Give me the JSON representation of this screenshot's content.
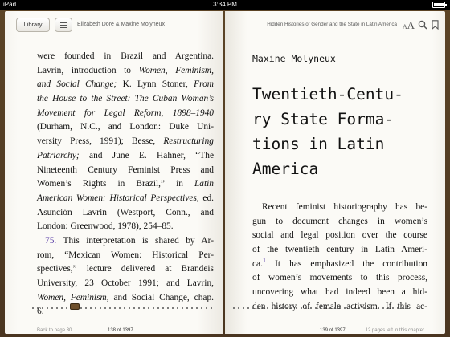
{
  "status": {
    "device": "iPad",
    "time": "3:34 PM",
    "battery_level": 0.9
  },
  "toolbar": {
    "library_label": "Library",
    "left_header": "Elizabeth Dore & Maxine Molyneux",
    "right_header": "Hidden Histories of Gender and the State in Latin America",
    "font_small": "A",
    "font_large": "A"
  },
  "left_page": {
    "lines": [
      "were founded in Brazil and Argentina.",
      "Lavrin, introduction to Women, Feminism,",
      "and Social Change; K. Lynn Stoner, From",
      "the House to the Street: The Cuban Woman’s",
      "Movement for Legal Reform, 1898–1940",
      "(Durham, N.C., and London: Duke Uni-",
      "versity Press, 1991); Besse, Restructuring",
      "Patriarchy; and June E. Hahner, “The",
      "Nineteenth Century Feminist Press and",
      "Women’s Rights in Brazil,” in Latin",
      "American Women: Historical Perspectives, ed.",
      "Asunción Lavrin (Westport, Conn., and",
      "London: Greenwood, 1978), 254–85."
    ],
    "note_number": "75.",
    "note_lines": [
      "This interpretation is shared by Ar-",
      "rom, “Mexican Women: Historical Per-",
      "spectives,” lecture delivered at Brandeis",
      "University, 23 October 1991; and Lavrin,",
      "Women, Feminism, and Social Change, chap.",
      "6."
    ]
  },
  "right_page": {
    "author": "Maxine Molyneux",
    "title_lines": [
      "Twentieth-Centu-",
      "ry State Forma-",
      "tions in Latin",
      "America"
    ],
    "body_lines": [
      "Recent feminist historiography has be-",
      "gun to document changes in women’s",
      "social and legal position over the course",
      "of the twentieth century in Latin Ameri-",
      "ca.",
      "It has emphasized the contribution",
      "of women’s movements to this process,",
      "uncovering what had indeed been a hid-",
      "den history of female activism. If this ac-"
    ],
    "footnote_ref": "1"
  },
  "footer": {
    "back_label": "Back to page 30",
    "left_page_indicator": "138 of 1397",
    "right_page_indicator": "139 of 1397",
    "pages_left": "12 pages left in this chapter"
  },
  "scrubber": {
    "position_fraction": 0.099
  }
}
